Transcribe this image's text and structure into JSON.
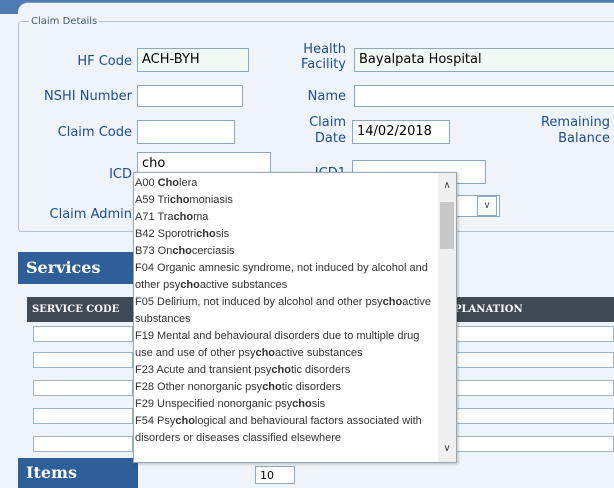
{
  "claim_details": {
    "legend": "Claim Details",
    "hf_code_label": "HF Code",
    "hf_code_value": "ACH-BYH",
    "health_facility_label_1": "Health",
    "health_facility_label_2": "Facility",
    "health_facility_value": "Bayalpata Hospital",
    "nshi_label": "NSHI Number",
    "nshi_value": "",
    "name_label": "Name",
    "name_value": "",
    "claim_code_label": "Claim Code",
    "claim_code_value": "",
    "claim_date_label_1": "Claim",
    "claim_date_label_2": "Date",
    "claim_date_value": "14/02/2018",
    "remaining_label_1": "Remaining",
    "remaining_label_2": "Balance",
    "icd_label": "ICD",
    "icd_value": "cho",
    "icd1_label": "ICD1",
    "claim_admin_label": "Claim Admin"
  },
  "dropdown": {
    "query": "cho",
    "items": [
      {
        "code": "A00",
        "pre": "",
        "match": "Cho",
        "post": "lera"
      },
      {
        "code": "A59",
        "pre": "Tri",
        "match": "cho",
        "post": "moniasis"
      },
      {
        "code": "A71",
        "pre": "Tra",
        "match": "cho",
        "post": "ma"
      },
      {
        "code": "B42",
        "pre": "Sporotri",
        "match": "cho",
        "post": "sis"
      },
      {
        "code": "B73",
        "pre": "On",
        "match": "cho",
        "post": "cerciasis"
      },
      {
        "code": "F04",
        "pre": "Organic amnesic syndrome, not induced by alcohol and other psy",
        "match": "cho",
        "post": "active substances"
      },
      {
        "code": "F05",
        "pre": "Delirium, not induced by alcohol and other psy",
        "match": "cho",
        "post": "active substances"
      },
      {
        "code": "F19",
        "pre": "Mental and behavioural disorders due to multiple drug use and use of other psy",
        "match": "cho",
        "post": "active substances"
      },
      {
        "code": "F23",
        "pre": "Acute and transient psy",
        "match": "cho",
        "post": "tic disorders"
      },
      {
        "code": "F28",
        "pre": "Other nonorganic psy",
        "match": "cho",
        "post": "tic disorders"
      },
      {
        "code": "F29",
        "pre": "Unspecified nonorganic psy",
        "match": "cho",
        "post": "sis"
      },
      {
        "code": "F54",
        "pre": "Psy",
        "match": "cho",
        "post": "logical and behavioural factors associated with disorders or diseases classified elsewhere"
      }
    ]
  },
  "services": {
    "title": "Services",
    "col_service_code": "SERVICE CODE",
    "col_explanation": "PLANATION"
  },
  "items": {
    "title": "Items",
    "value": "10"
  }
}
